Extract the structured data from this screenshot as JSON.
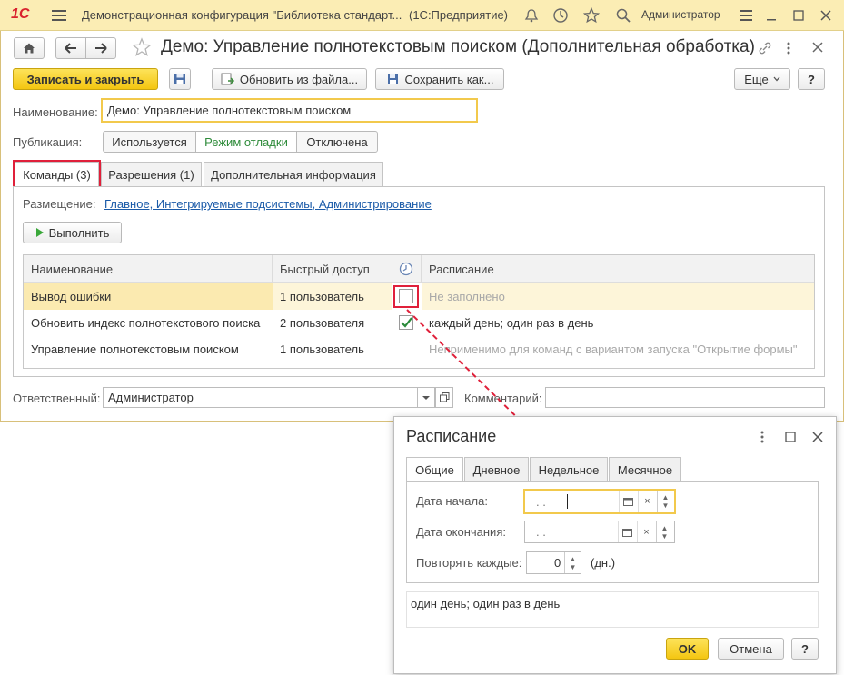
{
  "topbar": {
    "logo": "1С",
    "title": "Демонстрационная конфигурация \"Библиотека стандарт...",
    "app": "(1С:Предприятие)",
    "user": "Администратор"
  },
  "form": {
    "title": "Демо: Управление полнотекстовым поиском (Дополнительная обработка)",
    "toolbar": {
      "save_close": "Записать и закрыть",
      "update_from_file": "Обновить из файла...",
      "save_as": "Сохранить как...",
      "more": "Еще",
      "help": "?"
    },
    "name_label": "Наименование:",
    "name_value": "Демо: Управление полнотекстовым поиском",
    "publication_label": "Публикация:",
    "publication_options": [
      "Используется",
      "Режим отладки",
      "Отключена"
    ],
    "tabs": [
      "Команды (3)",
      "Разрешения (1)",
      "Дополнительная информация"
    ],
    "placement_label": "Размещение:",
    "placement_value": "Главное, Интегрируемые подсистемы, Администрирование",
    "execute_button": "Выполнить",
    "table": {
      "headers": [
        "Наименование",
        "Быстрый доступ",
        "",
        "Расписание"
      ],
      "rows": [
        {
          "name": "Вывод ошибки",
          "access": "1 пользователь",
          "checked": false,
          "schedule": "Не заполнено"
        },
        {
          "name": "Обновить индекс полнотекстового поиска",
          "access": "2 пользователя",
          "checked": true,
          "schedule": "каждый день; один раз в день"
        },
        {
          "name": "Управление полнотекстовым поиском",
          "access": "1 пользователь",
          "checked": false,
          "schedule": "Неприменимо для команд с вариантом запуска \"Открытие формы\""
        }
      ]
    },
    "responsible_label": "Ответственный:",
    "responsible_value": "Администратор",
    "comment_label": "Комментарий:",
    "comment_value": ""
  },
  "popup": {
    "title": "Расписание",
    "tabs": [
      "Общие",
      "Дневное",
      "Недельное",
      "Месячное"
    ],
    "start_label": "Дата начала:",
    "start_value": " .  .",
    "end_label": "Дата окончания:",
    "end_value": " .  .",
    "repeat_label": "Повторять каждые:",
    "repeat_value": "0",
    "repeat_unit": "(дн.)",
    "summary": "один день; один раз в день",
    "ok": "OK",
    "cancel": "Отмена",
    "help": "?"
  },
  "colors": {
    "accent_yellow": "#f4c611",
    "topbar_bg": "#fbedb4",
    "highlight_red": "#e0203a",
    "selected_row": "#fbeab0",
    "link": "#1a5aa8",
    "green_text": "#2e8b3a"
  }
}
